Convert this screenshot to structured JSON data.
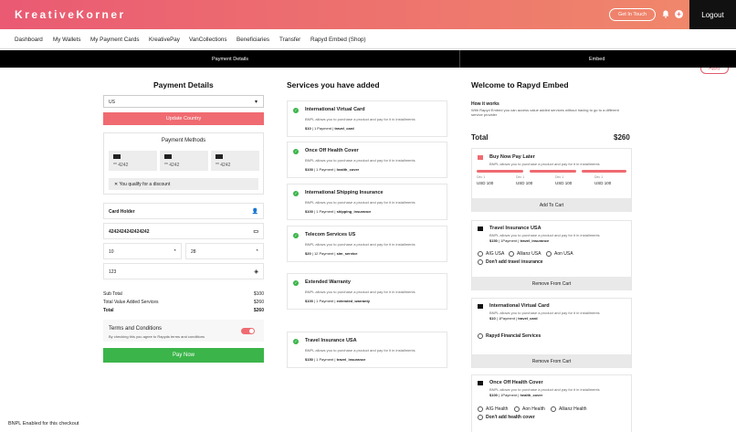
{
  "header": {
    "brand": "KreativeKorner",
    "get_in_touch": "Get In Touch",
    "logout": "Logout",
    "apply": "Apply"
  },
  "nav": [
    "Dashboard",
    "My Wallets",
    "My Payment Cards",
    "KreativePay",
    "VanCollections",
    "Beneficiaries",
    "Transfer",
    "Rapyd Embed (Shop)"
  ],
  "tabs": {
    "left": "Payment Details",
    "right": "Embed"
  },
  "payment": {
    "title": "Payment Details",
    "country": "US",
    "update_country": "Update Country",
    "methods_title": "Payment Methods",
    "cards": [
      {
        "brand": "VISA",
        "number": "4242"
      },
      {
        "brand": "VISA",
        "number": "4242"
      },
      {
        "brand": "VISA",
        "number": "4242"
      }
    ],
    "qualify": "You qualify for a discount",
    "card_holder": "Card Holder",
    "card_number": "4242424242424242",
    "exp_month": "10",
    "exp_year": "28",
    "cvv": "123",
    "sub_total_label": "Sub Total",
    "sub_total": "$100",
    "vas_label": "Total Value Added Services",
    "vas": "$260",
    "total_label": "Total",
    "total": "$260",
    "terms_title": "Terms and Conditions",
    "terms_sub": "By checking this you agree to Rapyds terms and conditions",
    "pay_now": "Pay Now"
  },
  "bnpl_note": "BNPL Enabled for this checkout",
  "services": {
    "title": "Services you have added",
    "items": [
      {
        "title": "International Virtual Card",
        "desc": "BNPL allows you to purchase a product and pay for it in installments",
        "price": "$10",
        "payments": "1 Payment",
        "code": "travel_card"
      },
      {
        "title": "Once Off Health Cover",
        "desc": "BNPL allows you to purchase a product and pay for it in installments",
        "price": "$100",
        "payments": "1 Payment",
        "code": "health_cover"
      },
      {
        "title": "International Shipping Insurance",
        "desc": "BNPL allows you to purchase a product and pay for it in installments",
        "price": "$100",
        "payments": "1 Payment",
        "code": "shipping_insurance"
      },
      {
        "title": "Telecom Services US",
        "desc": "BNPL allows you to purchase a product and pay for it in installments",
        "price": "$20",
        "payments": "12 Payment",
        "code": "sim_service"
      },
      {
        "title": "Extended Warranty",
        "desc": "BNPL allows you to purchase a product and pay for it in installments",
        "price": "$100",
        "payments": "1 Payment",
        "code": "extended_warranty"
      },
      {
        "title": "Travel Insurance USA",
        "desc": "BNPL allows you to purchase a product and pay for it in installments",
        "price": "$150",
        "payments": "1 Payment",
        "code": "travel_insurance"
      }
    ]
  },
  "embed": {
    "title": "Welcome to Rapyd Embed",
    "how_title": "How it works",
    "how_desc": "With Rapyd Embed you can access value added services without having to go to a different service provider",
    "total_label": "Total",
    "total": "$260",
    "bnpl": {
      "title": "Buy Now Pay Later",
      "desc": "BNPL allows you to purchase a product and pay for it in installments",
      "installments": [
        {
          "label": "Dec 1",
          "amount": "USD 100"
        },
        {
          "label": "Dec 1",
          "amount": "USD 100"
        },
        {
          "label": "Dec 1",
          "amount": "USD 100"
        },
        {
          "label": "Dec 1",
          "amount": "USD 100"
        }
      ],
      "button": "Add To Cart"
    },
    "travel": {
      "title": "Travel Insurance USA",
      "desc": "BNPL allows you to purchase a product and pay for it in installments",
      "price": "$150",
      "payments": "1Payment",
      "code": "travel_insurance",
      "options": [
        "AIG USA",
        "Allianz USA",
        "Aon USA",
        "Don't add travel insurance"
      ],
      "button": "Remove From Cart"
    },
    "card": {
      "title": "International Virtual Card",
      "desc": "BNPL allows you to purchase a product and pay for it in installments",
      "price": "$10",
      "payments": "1Payment",
      "code": "travel_card",
      "options": [
        "Rapyd Financial Services"
      ],
      "button": "Remove From Cart"
    },
    "health": {
      "title": "Once Off Health Cover",
      "desc": "BNPL allows you to purchase a product and pay for it in installments",
      "price": "$100",
      "payments": "1Payment",
      "code": "health_cover",
      "options": [
        "AIG Health",
        "Aon Health",
        "Allianz Health",
        "Don't add health cover"
      ]
    }
  }
}
